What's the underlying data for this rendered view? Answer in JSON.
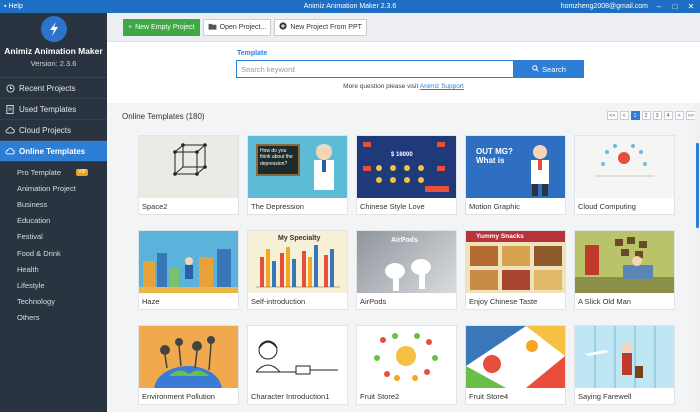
{
  "titlebar": {
    "menu_label": "Help",
    "title": "Animiz Animation Maker 2.3.6",
    "user": "homzheng2008@gmail.com"
  },
  "sidebar": {
    "app_name": "Animiz Animation Maker",
    "version": "Version: 2.3.6",
    "nav": [
      {
        "label": "Recent Projects",
        "icon": "clock-icon"
      },
      {
        "label": "Used Templates",
        "icon": "document-icon"
      },
      {
        "label": "Cloud Projects",
        "icon": "cloud-icon"
      },
      {
        "label": "Online Templates",
        "icon": "cloud-icon"
      }
    ],
    "sub": [
      {
        "label": "Pro Template",
        "badge": "VIP"
      },
      {
        "label": "Animation Project"
      },
      {
        "label": "Business"
      },
      {
        "label": "Education"
      },
      {
        "label": "Festival"
      },
      {
        "label": "Food & Drink"
      },
      {
        "label": "Health"
      },
      {
        "label": "Lifestyle"
      },
      {
        "label": "Technology"
      },
      {
        "label": "Others"
      }
    ]
  },
  "toolbar": {
    "new_empty": "New Empty Project",
    "open": "Open Project...",
    "from_ppt": "New Project From PPT"
  },
  "search": {
    "label": "Template",
    "placeholder": "Search keyword",
    "button": "Search",
    "hint_prefix": "More question please visit",
    "hint_link": "Animiz Support"
  },
  "online": {
    "heading": "Online Templates (180)",
    "pager": [
      "<<",
      "<",
      "1",
      "2",
      "3",
      "4",
      ">",
      ">>"
    ],
    "active_page": "1"
  },
  "templates": [
    {
      "name": "Space2"
    },
    {
      "name": "The Depression",
      "thumb_text": "How do you think about the depression?"
    },
    {
      "name": "Chinese Style Love",
      "thumb_text": "$ 16000"
    },
    {
      "name": "Motion Graphic",
      "thumb_text": "OUT MG? What is"
    },
    {
      "name": "Cloud Computing"
    },
    {
      "name": "Haze"
    },
    {
      "name": "Self-introduction",
      "thumb_text": "My Specialty"
    },
    {
      "name": "AirPods",
      "thumb_text": "AirPods"
    },
    {
      "name": "Enjoy Chinese Taste",
      "thumb_text": "Yummy Snacks"
    },
    {
      "name": "A Slick Old Man"
    },
    {
      "name": "Environment Pollution"
    },
    {
      "name": "Character Introduction1"
    },
    {
      "name": "Fruit Store2"
    },
    {
      "name": "Fruit Store4"
    },
    {
      "name": "Saying Farewell"
    }
  ],
  "colors": {
    "accent": "#2d7fd6",
    "sidebar_bg": "#2a3440",
    "green": "#3ea845",
    "vip": "#e3a22a"
  }
}
